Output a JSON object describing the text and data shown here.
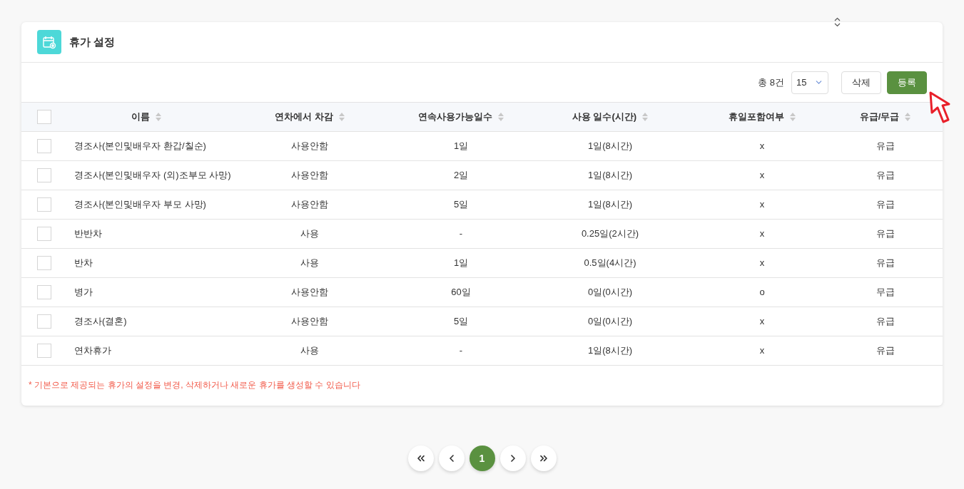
{
  "card": {
    "title": "휴가 설정"
  },
  "toolbar": {
    "total": "총 8건",
    "page_size": "15",
    "buttons": [
      {
        "kind": "outline",
        "label": "삭제"
      },
      {
        "kind": "primary",
        "label": "등록"
      }
    ]
  },
  "table": {
    "columns": [
      "이름",
      "연차에서 차감",
      "연속사용가능일수",
      "사용 일수(시간)",
      "휴일포함여부",
      "유급/무급"
    ],
    "header_checked": false,
    "rows": [
      {
        "checked": false,
        "cells": [
          "경조사(본인및배우자 환갑/칠순)",
          "사용안함",
          "1일",
          "1일(8시간)",
          "x",
          "유급"
        ]
      },
      {
        "checked": false,
        "cells": [
          "경조사(본인및배우자 (외)조부모 사망)",
          "사용안함",
          "2일",
          "1일(8시간)",
          "x",
          "유급"
        ]
      },
      {
        "checked": false,
        "cells": [
          "경조사(본인및배우자 부모 사망)",
          "사용안함",
          "5일",
          "1일(8시간)",
          "x",
          "유급"
        ]
      },
      {
        "checked": false,
        "cells": [
          "반반차",
          "사용",
          "-",
          "0.25일(2시간)",
          "x",
          "유급"
        ]
      },
      {
        "checked": false,
        "cells": [
          "반차",
          "사용",
          "1일",
          "0.5일(4시간)",
          "x",
          "유급"
        ]
      },
      {
        "checked": false,
        "cells": [
          "병가",
          "사용안함",
          "60일",
          "0일(0시간)",
          "o",
          "무급"
        ]
      },
      {
        "checked": false,
        "cells": [
          "경조사(결혼)",
          "사용안함",
          "5일",
          "0일(0시간)",
          "x",
          "유급"
        ]
      },
      {
        "checked": false,
        "cells": [
          "연차휴가",
          "사용",
          "-",
          "1일(8시간)",
          "x",
          "유급"
        ]
      }
    ]
  },
  "note": "* 기본으로 제공되는 휴가의 설정을 변경, 삭제하거나 새로운 휴가를 생성할 수 있습니다",
  "pagination": [
    {
      "kind": "first"
    },
    {
      "kind": "prev"
    },
    {
      "kind": "page",
      "label": "1",
      "selected": true
    },
    {
      "kind": "next"
    },
    {
      "kind": "last"
    }
  ]
}
